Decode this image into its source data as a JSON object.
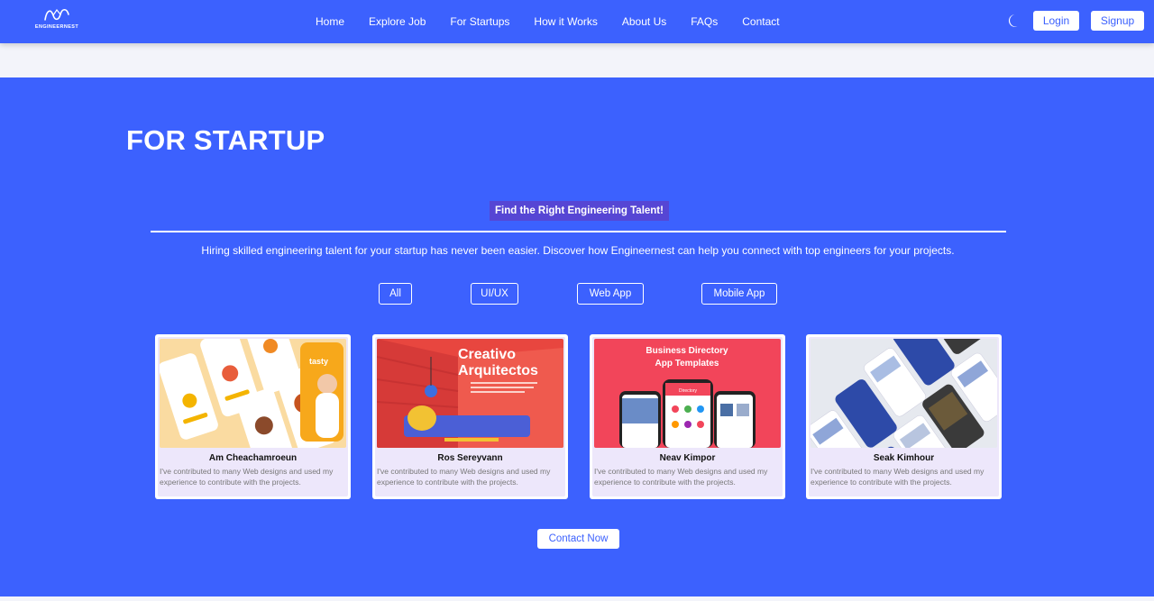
{
  "brand": {
    "logo_text": "ENGINEERNEST"
  },
  "nav": {
    "links": [
      "Home",
      "Explore Job",
      "For Startups",
      "How it Works",
      "About Us",
      "FAQs",
      "Contact"
    ],
    "login": "Login",
    "signup": "Signup",
    "theme_icon": "moon-icon"
  },
  "hero": {
    "title": "FOR STARTUP",
    "subtitle": "Find the Right Engineering Talent!",
    "description": "Hiring skilled engineering talent for your startup has never been easier. Discover how Engineernest can help you connect with top engineers for your projects."
  },
  "filters": [
    "All",
    "UI/UX",
    "Web App",
    "Mobile App"
  ],
  "cards": [
    {
      "name": "Am Cheachamroeun",
      "description": "I've contributed to many Web designs and used my experience to contribute with the projects.",
      "image_text": [
        "tasty"
      ]
    },
    {
      "name": "Ros Sereyvann",
      "description": "I've contributed to many Web designs and used my experience to contribute with the projects.",
      "image_text": [
        "Creativo",
        "Arquitectos"
      ]
    },
    {
      "name": "Neav Kimpor",
      "description": "I've contributed to many Web designs and used my experience to contribute with the projects.",
      "image_text": [
        "Business Directory",
        "App Templates",
        "Directory"
      ]
    },
    {
      "name": "Seak Kimhour",
      "description": "I've contributed to many Web designs and used my experience to contribute with the projects.",
      "image_text": []
    }
  ],
  "cta": {
    "label": "Contact Now"
  },
  "colors": {
    "primary": "#3c61fe",
    "badge": "#5646d4",
    "card_bg": "#ede7fb"
  }
}
